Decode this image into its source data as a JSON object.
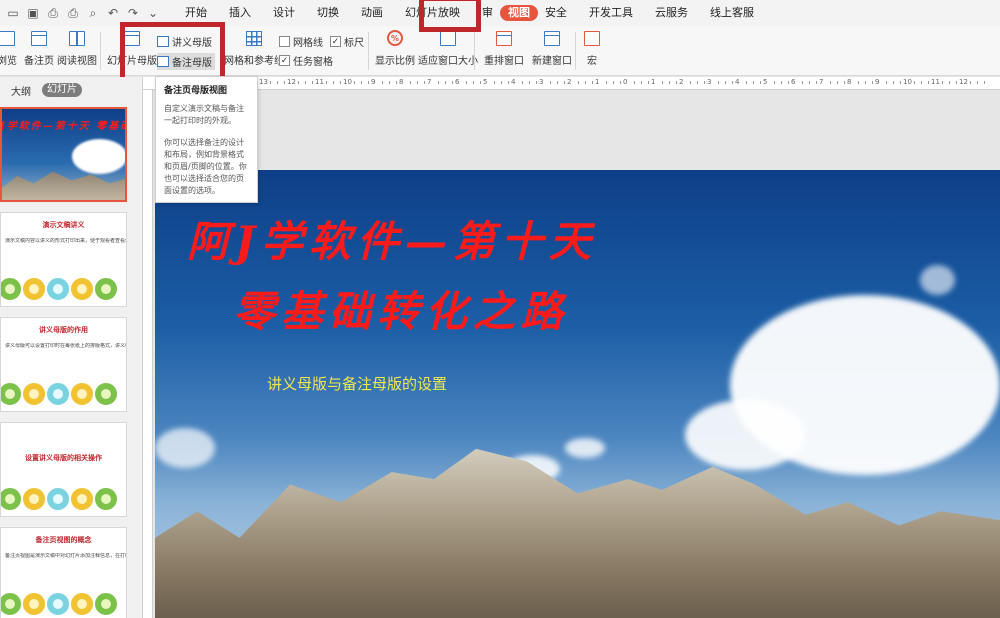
{
  "menubar": {
    "quick_icons": [
      "folder-icon",
      "save-icon",
      "print-preview-icon",
      "print-icon",
      "format-painter-icon",
      "undo-icon",
      "redo-icon",
      "customize-icon"
    ],
    "tabs": [
      "开始",
      "插入",
      "设计",
      "切换",
      "动画",
      "幻灯片放映",
      "审",
      "视图",
      "安全",
      "开发工具",
      "云服务",
      "线上客服"
    ],
    "active_tab": "视图"
  },
  "ribbon": {
    "browse": "浏览",
    "notes_page": "备注页",
    "reading_view": "阅读视图",
    "slide_master": "幻灯片母版",
    "handout_master": "讲义母版",
    "notes_master": "备注母版",
    "grid_guides": "网格和参考线",
    "gridlines": "网格线",
    "ruler": "标尺",
    "task_pane": "任务窗格",
    "zoom": "显示比例",
    "fit_window": "适应窗口大小",
    "arrange_window": "重排窗口",
    "new_window": "新建窗口",
    "macro": "宏"
  },
  "left_panel": {
    "tab_outline": "大纲",
    "tab_slides": "幻灯片",
    "thumbs": [
      {
        "title": "阿J学软件—第十天 零基础转化之路",
        "text": ""
      },
      {
        "title": "演示文稿讲义",
        "text": "演示文稿内容以讲义的形式打印出来，便于观看者查看演示文稿内容"
      },
      {
        "title": "讲义母版的作用",
        "text": "讲义母版可以设置打印时在每张纸上的排版格式，讲义中幻灯片的数量、页眉页脚等"
      },
      {
        "title": "设置讲义母版的相关操作",
        "text": ""
      },
      {
        "title": "备注页视图的概念",
        "text": "备注页视图是演示文稿中对幻灯片添加注释信息，在打印时，可以打印备注页"
      }
    ]
  },
  "tooltip": {
    "title": "备注页母版视图",
    "para1": "自定义演示文稿与备注一起打印时的外观。",
    "para2": "你可以选择备注的设计和布局，例如背景格式和页眉/页脚的位置。你也可以选择适合您的页面设置的选项。"
  },
  "ruler": {
    "numbers": [
      "13",
      "12",
      "11",
      "10",
      "9",
      "8",
      "7",
      "6",
      "5",
      "4",
      "3",
      "2",
      "1",
      "0",
      "1",
      "2",
      "3",
      "4",
      "5",
      "6",
      "7",
      "8",
      "9",
      "10",
      "11",
      "12",
      "13"
    ]
  },
  "slide": {
    "title_line1": "阿J学软件—第十天",
    "title_line2": "零基础转化之路",
    "subtitle": "讲义母版与备注母版的设置"
  },
  "colors": {
    "accent": "#e8553e",
    "highlight_box": "#c0272d",
    "slide_title": "#ff1a1a",
    "slide_subtitle": "#f2e84a"
  }
}
